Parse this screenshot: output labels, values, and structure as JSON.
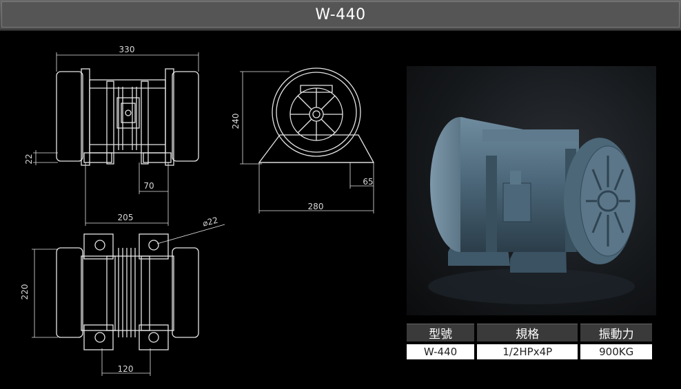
{
  "title": "W-440",
  "dimensions": {
    "top_width": "330",
    "side_height": "22",
    "inner_offset": "70",
    "inner_span": "205",
    "front_height": "240",
    "front_foot": "65",
    "front_width": "280",
    "hole_diameter": "⌀22",
    "bottom_height": "220",
    "bottom_span": "120"
  },
  "spec_table": {
    "headers": [
      "型號",
      "規格",
      "振動力"
    ],
    "values": [
      "W-440",
      "1/2HPx4P",
      "900KG"
    ]
  }
}
